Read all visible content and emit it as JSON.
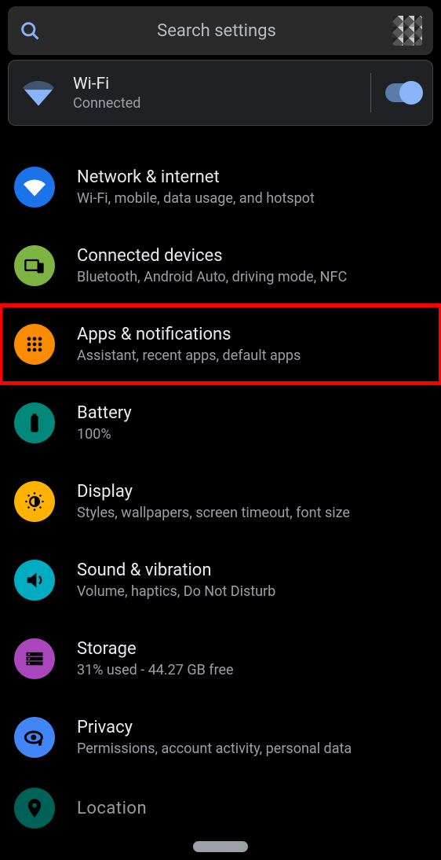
{
  "search": {
    "placeholder": "Search settings"
  },
  "wifi_card": {
    "title": "Wi-Fi",
    "status": "Connected",
    "toggle_on": true
  },
  "items": [
    {
      "title": "Network & internet",
      "sub": "Wi-Fi, mobile, data usage, and hotspot",
      "color": "c-blue",
      "icon": "wifi",
      "highlighted": false
    },
    {
      "title": "Connected devices",
      "sub": "Bluetooth, Android Auto, driving mode, NFC",
      "color": "c-green",
      "icon": "devices",
      "highlighted": false
    },
    {
      "title": "Apps & notifications",
      "sub": "Assistant, recent apps, default apps",
      "color": "c-orange",
      "icon": "apps",
      "highlighted": true
    },
    {
      "title": "Battery",
      "sub": "100%",
      "color": "c-teal",
      "icon": "battery",
      "highlighted": false
    },
    {
      "title": "Display",
      "sub": "Styles, wallpapers, screen timeout, font size",
      "color": "c-amber",
      "icon": "brightness",
      "highlighted": false
    },
    {
      "title": "Sound & vibration",
      "sub": "Volume, haptics, Do Not Disturb",
      "color": "c-cyan",
      "icon": "sound",
      "highlighted": false
    },
    {
      "title": "Storage",
      "sub": "31% used - 44.27 GB free",
      "color": "c-purple",
      "icon": "storage",
      "highlighted": false
    },
    {
      "title": "Privacy",
      "sub": "Permissions, account activity, personal data",
      "color": "c-blue2",
      "icon": "privacy",
      "highlighted": false
    },
    {
      "title": "Location",
      "sub": "",
      "color": "c-teal2",
      "icon": "location",
      "highlighted": false
    }
  ]
}
